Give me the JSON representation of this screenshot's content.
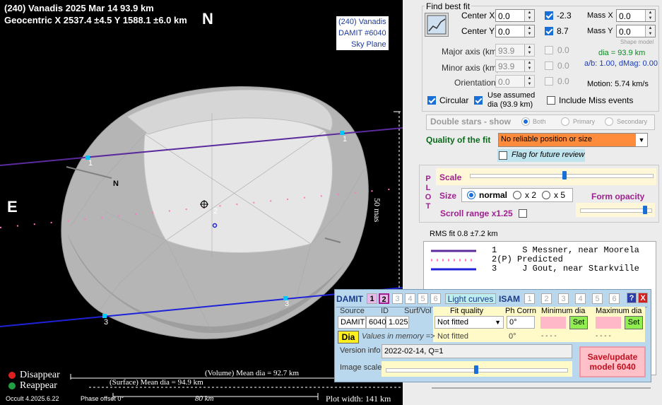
{
  "plot": {
    "title_line1": "(240) Vanadis  2025 Mar 14   93.9 km",
    "title_line2": "Geocentric  X  2537.4 ±4.5  Y 1588.1 ±6.0 km",
    "north_label": "N",
    "east_label": "E",
    "damit_lines": [
      "(240) Vanadis",
      "DAMIT #6040",
      "Sky Plane"
    ],
    "chord_labels": [
      "1",
      "1",
      "2",
      "3",
      "3"
    ],
    "pole_label": "N",
    "scale_label": "50 mas",
    "legend_disappear": "Disappear",
    "legend_reappear": "Reappear",
    "volume_dia": "(Volume) Mean dia = 92.7 km",
    "surface_dia": "(Surface) Mean dia = 94.9 km",
    "version": "Occult 4.2025.6.22",
    "phase_offset": "Phase offset 0°",
    "scale_km": "80 km",
    "plot_width": "Plot width: 141 km",
    "colors": {
      "disappear": "#e02020",
      "reappear": "#20a040",
      "chord1": "#5b2a9c",
      "chord3": "#1e22d8",
      "predicted": "#ff77c0",
      "marker": "#00c8ff"
    }
  },
  "fit": {
    "title": "Find best fit",
    "center_x_label": "Center X",
    "center_x_value": "0.0",
    "center_y_label": "Center Y",
    "center_y_value": "0.0",
    "cx_result": "-2.3",
    "cy_result": "8.7",
    "mass_x_label": "Mass X",
    "mass_x_value": "0.0",
    "mass_y_label": "Mass Y",
    "mass_y_value": "0.0",
    "shape_model_label": "Shape model",
    "major_label": "Major axis (km)",
    "major_value": "93.9",
    "major_result": "0.0",
    "minor_label": "Minor axis (km)",
    "minor_value": "93.9",
    "minor_result": "0.0",
    "orient_label": "Orientation",
    "orient_value": "0.0",
    "orient_result": "0.0",
    "dia_text": "dia = 93.9 km",
    "ab_text": "a/b: 1.00, dMag: 0.00",
    "motion_text": "Motion: 5.74 km/s",
    "circular_label": "Circular",
    "assumed_label_1": "Use assumed",
    "assumed_label_2": "dia (93.9 km)",
    "miss_label": "Include Miss events",
    "double_label": "Double stars - show",
    "both_label": "Both",
    "primary_label": "Primary",
    "secondary_label": "Secondary",
    "quality_label": "Quality of the fit",
    "quality_value": "No reliable position or size",
    "flag_label": "Flag for future review"
  },
  "plotctl": {
    "plot_vertical": [
      "P",
      "L",
      "O",
      "T"
    ],
    "scale_label": "Scale",
    "size_label": "Size",
    "size_normal": "normal",
    "size_x2": "x 2",
    "size_x5": "x 5",
    "opacity_label": "Form opacity",
    "scroll_label": "Scroll range x1.25",
    "scale_slider_fraction": 0.52,
    "opacity_slider_fraction": 0.95
  },
  "rms": "RMS fit 0.8 ±7.2 km",
  "legend": [
    {
      "num": "1",
      "name": "S Messner, near Moorela"
    },
    {
      "num": "2(P)",
      "name": "Predicted"
    },
    {
      "num": "3",
      "name": "J Gout, near Starkville"
    }
  ],
  "damit": {
    "damit_label": "DAMIT",
    "damit_tabs": [
      "1",
      "2",
      "3",
      "4",
      "5",
      "6"
    ],
    "light_curves": "Light curves",
    "isam_label": "ISAM",
    "isam_tabs": [
      "1",
      "2",
      "3",
      "4",
      "5",
      "6"
    ],
    "help": "?",
    "close": "X",
    "hdr_source": "Source",
    "hdr_id": "ID",
    "hdr_surf": "Surf/Vol",
    "hdr_fit": "Fit quality",
    "hdr_ph": "Ph Corrn",
    "hdr_min": "Minimum dia",
    "hdr_max": "Maximum dia",
    "source": "DAMIT",
    "id": "6040",
    "surf": "1.025",
    "fit_value": "Not fitted",
    "ph_value": "0°",
    "set1": "Set",
    "set2": "Set",
    "dia_button": "Dia",
    "values_memory": "Values in memory =>",
    "mem_fit": "Not fitted",
    "mem_ph": "0°",
    "mem_min": "- - - -",
    "mem_max": "- - - -",
    "version_label": "Version info",
    "version_value": "2022-02-14, Q=1",
    "image_scale_label": "Image scale",
    "image_scale_fraction": 0.5,
    "save_line1": "Save/update",
    "save_line2": "model 6040"
  }
}
